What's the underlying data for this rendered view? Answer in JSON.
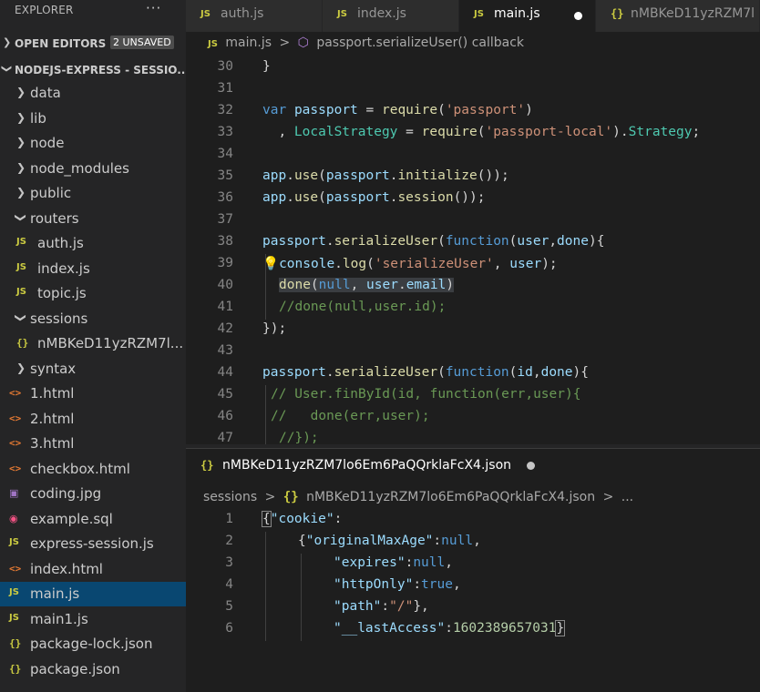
{
  "sidebar": {
    "title": "EXPLORER",
    "more": "···",
    "open_editors": {
      "label": "OPEN EDITORS",
      "badge": "2 UNSAVED"
    },
    "project": {
      "label": "NODEJS-EXPRESS - SESSIO..."
    },
    "items": [
      {
        "label": "data",
        "kind": "folder",
        "depth": 0
      },
      {
        "label": "lib",
        "kind": "folder",
        "depth": 0
      },
      {
        "label": "node",
        "kind": "folder",
        "depth": 0
      },
      {
        "label": "node_modules",
        "kind": "folder",
        "depth": 0
      },
      {
        "label": "public",
        "kind": "folder",
        "depth": 0
      },
      {
        "label": "routers",
        "kind": "folder-open",
        "depth": 0
      },
      {
        "label": "auth.js",
        "kind": "js",
        "depth": 1
      },
      {
        "label": "index.js",
        "kind": "js",
        "depth": 1
      },
      {
        "label": "topic.js",
        "kind": "js",
        "depth": 1
      },
      {
        "label": "sessions",
        "kind": "folder-open",
        "depth": 0
      },
      {
        "label": "nMBKeD11yzRZM7l...",
        "kind": "json",
        "depth": 1
      },
      {
        "label": "syntax",
        "kind": "folder",
        "depth": 0
      },
      {
        "label": "1.html",
        "kind": "html",
        "depth": 0
      },
      {
        "label": "2.html",
        "kind": "html",
        "depth": 0
      },
      {
        "label": "3.html",
        "kind": "html",
        "depth": 0
      },
      {
        "label": "checkbox.html",
        "kind": "html",
        "depth": 0
      },
      {
        "label": "coding.jpg",
        "kind": "img",
        "depth": 0
      },
      {
        "label": "example.sql",
        "kind": "sql",
        "depth": 0
      },
      {
        "label": "express-session.js",
        "kind": "js",
        "depth": 0
      },
      {
        "label": "index.html",
        "kind": "html",
        "depth": 0
      },
      {
        "label": "main.js",
        "kind": "js",
        "depth": 0,
        "selected": true
      },
      {
        "label": "main1.js",
        "kind": "js",
        "depth": 0
      },
      {
        "label": "package-lock.json",
        "kind": "json",
        "depth": 0
      },
      {
        "label": "package.json",
        "kind": "json",
        "depth": 0
      }
    ]
  },
  "icons": {
    "js": "JS",
    "json": "{}",
    "html": "<>",
    "folder_closed": "❯",
    "folder_open": "❯"
  },
  "tabs": [
    {
      "label": "auth.js",
      "icon": "JS",
      "active": false
    },
    {
      "label": "index.js",
      "icon": "JS",
      "active": false
    },
    {
      "label": "main.js",
      "icon": "JS",
      "active": true,
      "dirty": true
    },
    {
      "label": "nMBKeD11yzRZM7l",
      "icon": "{}",
      "active": false
    }
  ],
  "upper_breadcrumb": {
    "file": "main.js",
    "symbol": "passport.serializeUser() callback",
    "separator": ">"
  },
  "upper_editor": {
    "lines": [
      {
        "n": "30",
        "code": "}"
      },
      {
        "n": "31",
        "code": ""
      },
      {
        "n": "32",
        "code": "var passport = require('passport')"
      },
      {
        "n": "33",
        "code": "  , LocalStrategy = require('passport-local').Strategy;"
      },
      {
        "n": "34",
        "code": ""
      },
      {
        "n": "35",
        "code": "app.use(passport.initialize());"
      },
      {
        "n": "36",
        "code": "app.use(passport.session());"
      },
      {
        "n": "37",
        "code": ""
      },
      {
        "n": "38",
        "code": "passport.serializeUser(function(user,done){"
      },
      {
        "n": "39",
        "code": "console.log('serializeUser', user);"
      },
      {
        "n": "40",
        "code": "done(null, user.email)"
      },
      {
        "n": "41",
        "code": "//done(null,user.id);"
      },
      {
        "n": "42",
        "code": "});"
      },
      {
        "n": "43",
        "code": ""
      },
      {
        "n": "44",
        "code": "passport.serializeUser(function(id,done){"
      },
      {
        "n": "45",
        "code": "// User.finById(id, function(err,user){"
      },
      {
        "n": "46",
        "code": "//   done(err,user);"
      },
      {
        "n": "47",
        "code": "//});"
      }
    ]
  },
  "lower_tab": {
    "label": "nMBKeD11yzRZM7lo6Em6PaQQrklaFcX4.json",
    "icon": "{}"
  },
  "lower_breadcrumb": {
    "folder": "sessions",
    "file": "nMBKeD11yzRZM7lo6Em6PaQQrklaFcX4.json",
    "more": "...",
    "separator": ">"
  },
  "lower_editor": {
    "lines": [
      {
        "n": "1",
        "code": "{\"cookie\":"
      },
      {
        "n": "2",
        "code": "{\"originalMaxAge\":null,"
      },
      {
        "n": "3",
        "code": "\"expires\":null,"
      },
      {
        "n": "4",
        "code": "\"httpOnly\":true,"
      },
      {
        "n": "5",
        "code": "\"path\":\"/\"},"
      },
      {
        "n": "6",
        "code": "\"__lastAccess\":1602389657031}"
      }
    ]
  },
  "colors": {
    "sidebar_bg": "#252526",
    "editor_bg": "#1e1e1e",
    "selected_row": "#094771",
    "js_icon": "#cbcb41",
    "html_icon": "#e37933",
    "keyword": "#569cd6",
    "string": "#ce9178",
    "comment": "#6a9955"
  }
}
